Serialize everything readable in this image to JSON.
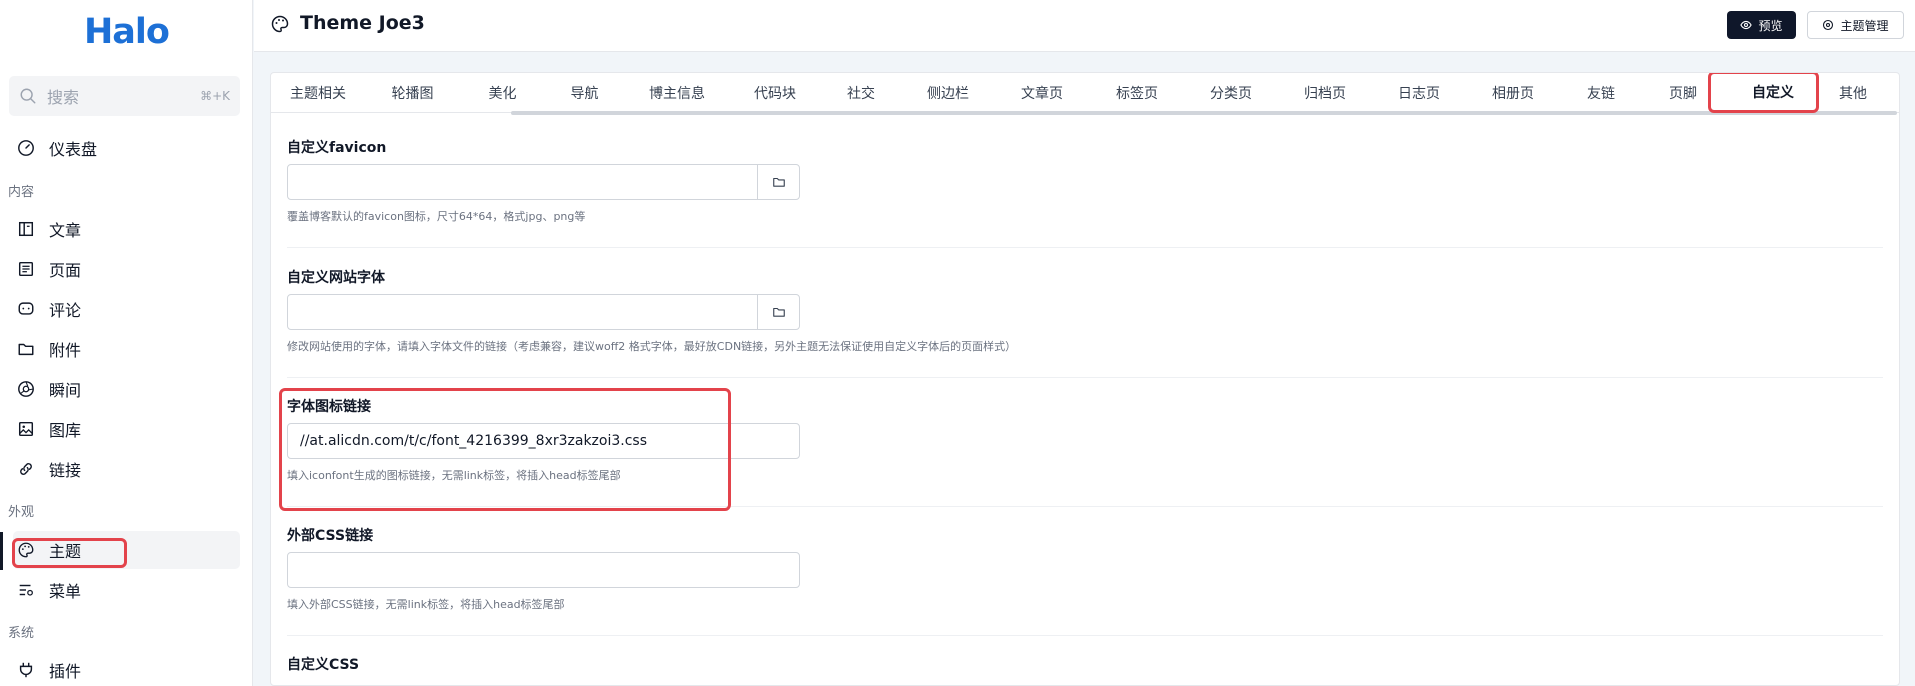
{
  "sidebar": {
    "logo": "Halo",
    "search": {
      "placeholder": "搜索",
      "shortcut": "⌘+K"
    },
    "items": {
      "dashboard": "仪表盘",
      "section_content": "内容",
      "posts": "文章",
      "pages": "页面",
      "comments": "评论",
      "attachments": "附件",
      "moments": "瞬间",
      "photos": "图库",
      "links": "链接",
      "section_appearance": "外观",
      "themes": "主题",
      "menus": "菜单",
      "section_system": "系统",
      "plugins": "插件"
    },
    "active_item": "themes"
  },
  "header": {
    "title": "Theme Joe3",
    "preview_label": "预览",
    "manage_label": "主题管理"
  },
  "tabs": [
    "主题相关",
    "轮播图",
    "美化",
    "导航",
    "博主信息",
    "代码块",
    "社交",
    "侧边栏",
    "文章页",
    "标签页",
    "分类页",
    "归档页",
    "日志页",
    "相册页",
    "友链",
    "页脚",
    "自定义",
    "其他"
  ],
  "active_tab": "自定义",
  "fields": {
    "favicon": {
      "label": "自定义favicon",
      "value": "",
      "help": "覆盖博客默认的favicon图标，尺寸64*64，格式jpg、png等"
    },
    "font": {
      "label": "自定义网站字体",
      "value": "",
      "help": "修改网站使用的字体，请填入字体文件的链接（考虑兼容，建议woff2 格式字体，最好放CDN链接，另外主题无法保证使用自定义字体后的页面样式）"
    },
    "iconfont": {
      "label": "字体图标链接",
      "value": "//at.alicdn.com/t/c/font_4216399_8xr3zakzoi3.css",
      "help": "填入iconfont生成的图标链接，无需link标签，将插入head标签尾部"
    },
    "external_css": {
      "label": "外部CSS链接",
      "value": "",
      "help": "填入外部CSS链接，无需link标签，将插入head标签尾部"
    },
    "custom_css": {
      "label": "自定义CSS"
    }
  },
  "colors": {
    "brand": "#1d70d6",
    "highlight": "#e3434b",
    "primary_button": "#0f172a"
  }
}
